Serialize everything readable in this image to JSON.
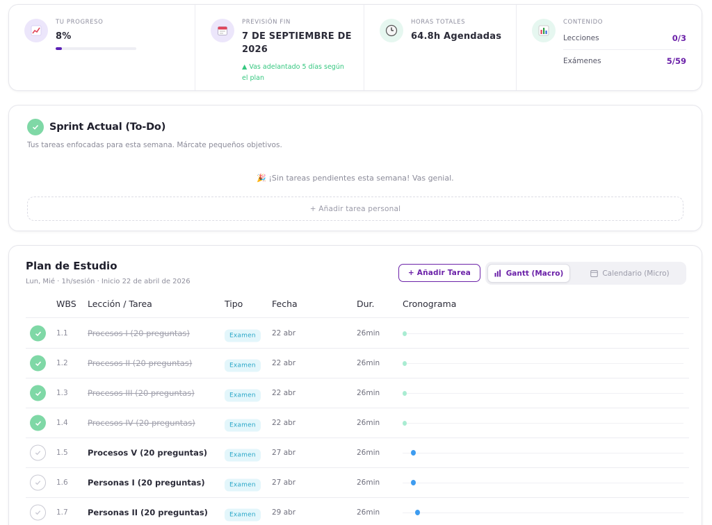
{
  "stats": {
    "progress": {
      "label": "TU PROGRESO",
      "value": "8%",
      "fraction": 0.08,
      "icon": "trend-chart-icon"
    },
    "forecast": {
      "label": "PREVISIÓN FIN",
      "value": "7 DE SEPTIEMBRE DE 2026",
      "note": "▲ Vas adelantado 5 días según el plan",
      "icon": "calendar-icon"
    },
    "hours": {
      "label": "HORAS TOTALES",
      "value": "64.8h Agendadas",
      "icon": "clock-icon"
    },
    "content": {
      "label": "CONTENIDO",
      "icon": "bar-chart-icon",
      "rows": [
        {
          "name": "Lecciones",
          "value": "0/3"
        },
        {
          "name": "Exámenes",
          "value": "5/59"
        }
      ]
    }
  },
  "sprint": {
    "title": "Sprint Actual (To-Do)",
    "subtitle": "Tus tareas enfocadas para esta semana. Márcate pequeños objetivos.",
    "empty_message": "🎉 ¡Sin tareas pendientes esta semana! Vas genial.",
    "add_label": "+ Añadir tarea personal"
  },
  "plan": {
    "title": "Plan de Estudio",
    "subtitle": "Lun, Mié · 1h/sesión · Inicio 22 de abril de 2026",
    "add_button": "+ Añadir Tarea",
    "view_gantt": "Gantt (Macro)",
    "view_calendar": "Calendario (Micro)",
    "columns": {
      "wbs": "WBS",
      "task": "Lección / Tarea",
      "type": "Tipo",
      "date": "Fecha",
      "duration": "Dur.",
      "timeline": "Cronograma"
    },
    "rows": [
      {
        "done": true,
        "wbs": "1.1",
        "task": "Procesos I (20 preguntas)",
        "type": "Examen",
        "date": "22 abr",
        "duration": "26min",
        "timeline_position": 0.0
      },
      {
        "done": true,
        "wbs": "1.2",
        "task": "Procesos II (20 preguntas)",
        "type": "Examen",
        "date": "22 abr",
        "duration": "26min",
        "timeline_position": 0.0
      },
      {
        "done": true,
        "wbs": "1.3",
        "task": "Procesos III (20 preguntas)",
        "type": "Examen",
        "date": "22 abr",
        "duration": "26min",
        "timeline_position": 0.0
      },
      {
        "done": true,
        "wbs": "1.4",
        "task": "Procesos IV (20 preguntas)",
        "type": "Examen",
        "date": "22 abr",
        "duration": "26min",
        "timeline_position": 0.0
      },
      {
        "done": false,
        "wbs": "1.5",
        "task": "Procesos V (20 preguntas)",
        "type": "Examen",
        "date": "27 abr",
        "duration": "26min",
        "timeline_position": 0.03
      },
      {
        "done": false,
        "wbs": "1.6",
        "task": "Personas I (20 preguntas)",
        "type": "Examen",
        "date": "27 abr",
        "duration": "26min",
        "timeline_position": 0.03
      },
      {
        "done": false,
        "wbs": "1.7",
        "task": "Personas II (20 preguntas)",
        "type": "Examen",
        "date": "29 abr",
        "duration": "26min",
        "timeline_position": 0.045
      }
    ]
  },
  "colors": {
    "accent": "#6b21a8",
    "progress_fill": "#5b21b6",
    "done_check": "#7fd8a6",
    "note_green": "#34c77f",
    "badge_bg": "#e3f6fb",
    "badge_text": "#2aa7c8",
    "gantt_done": "#a9ecd2",
    "gantt_pending": "#3e9cf0"
  }
}
